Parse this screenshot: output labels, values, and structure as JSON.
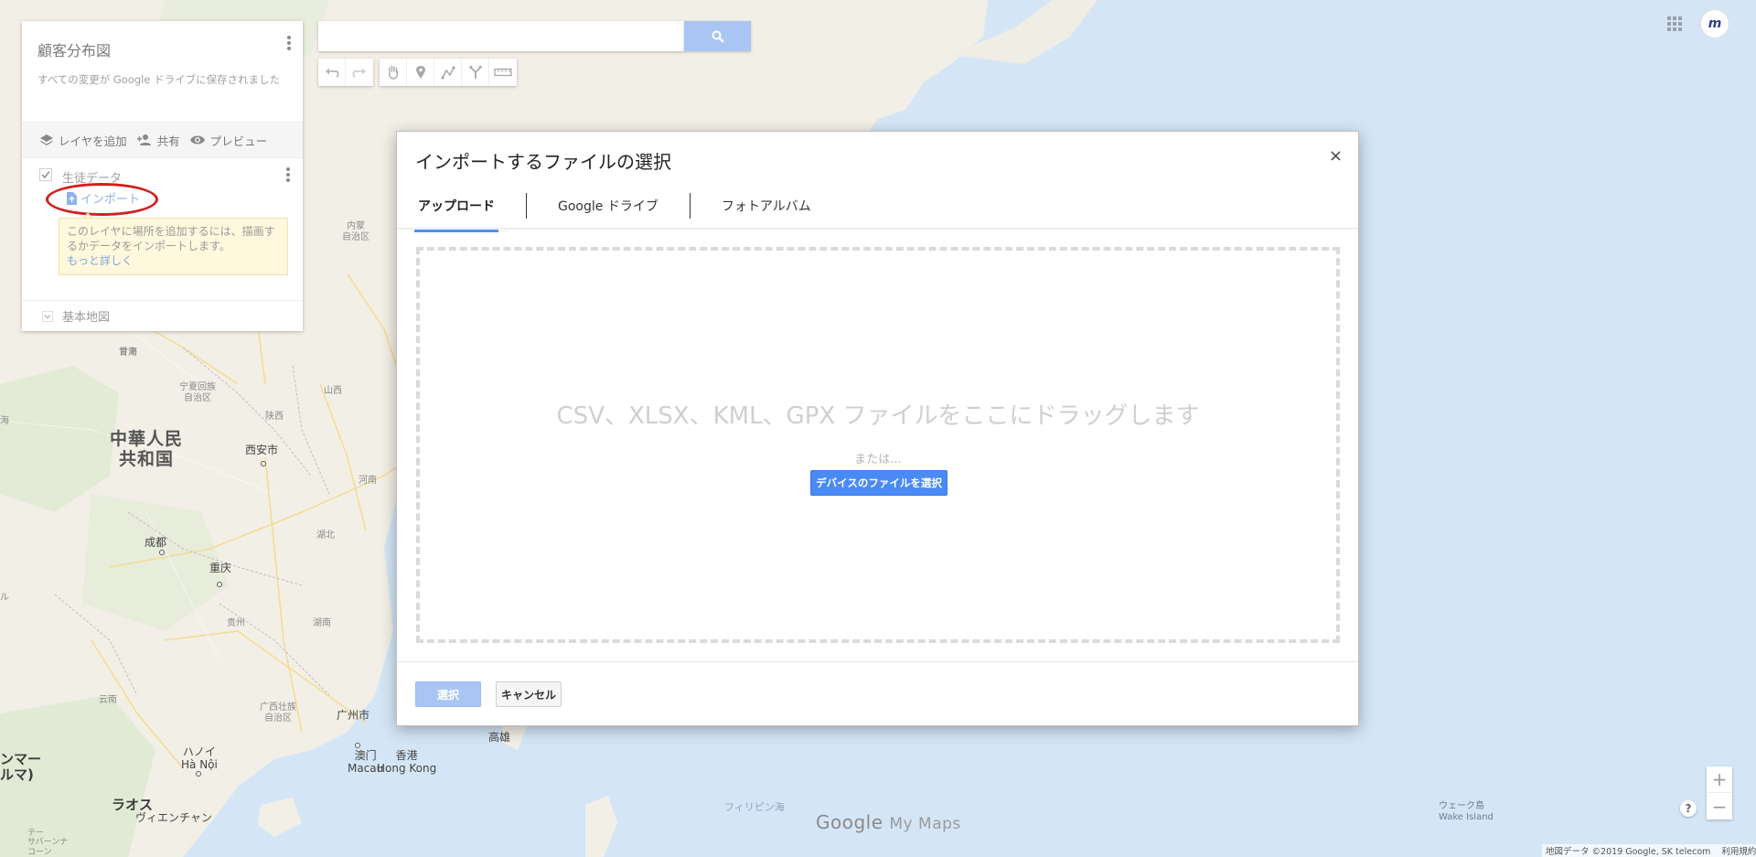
{
  "colors": {
    "water": "#d4e6f6",
    "land": "#f2efe6",
    "accent_blue": "#4a8af4",
    "disabled_blue": "#a9c5f3",
    "annotation_red": "#d21f1f",
    "hint_bg": "#fff8dc"
  },
  "left_panel": {
    "title": "顧客分布図",
    "save_status": "すべての変更が Google ドライブに保存されました",
    "actions": {
      "add_layer": "レイヤを追加",
      "share": "共有",
      "preview": "プレビュー"
    },
    "layer": {
      "name": "生徒データ",
      "import_label": "インポート",
      "hint_text": "このレイヤに場所を追加するには、描画するかデータをインポートします。",
      "hint_link": "もっと詳しく"
    },
    "base_map_label": "基本地図"
  },
  "search": {
    "value": "",
    "placeholder": ""
  },
  "toolbar": {
    "icons": [
      "undo-icon",
      "redo-icon",
      "hand-icon",
      "marker-icon",
      "draw-line-icon",
      "directions-icon",
      "ruler-icon"
    ]
  },
  "top_right": {
    "avatar_text": "m"
  },
  "map_labels": {
    "china": "中華人民\n共和国",
    "xian": "西安市",
    "chengdu": "成都",
    "chongqing": "重庆",
    "guangzhou": "广州市",
    "macau": "澳门\nMacau",
    "hongkong": "香港\nHong Kong",
    "hanoi": "ハノイ\nHà Nội",
    "laos": "ラオス",
    "vientiane": "ヴィエンチャン",
    "myanmar": "ンマー\nルマ)",
    "kaohsiung": "高雄",
    "ningxia": "宁夏回族\n自治区",
    "gansu": "甘肃",
    "shaanxi": "陕西",
    "shanxi": "山西",
    "henan": "河南",
    "hubei": "湖北",
    "hunan": "湖南",
    "guizhou": "贵州",
    "yunnan": "云南",
    "guangxi": "广西壮族\n自治区",
    "inner_mongolia": "内蒙\n自治区",
    "qinghai": "青海",
    "philippine_sea": "フィリピン海",
    "wake_island": "ウェーク島\nWake Island",
    "left_edge_1": "ル",
    "left_edge_2": "海",
    "tai": "テー\nサバーンナ\nコーン"
  },
  "dialog": {
    "title": "インポートするファイルの選択",
    "close_label": "×",
    "tabs": [
      {
        "label": "アップロード",
        "active": true
      },
      {
        "label": "Google ドライブ",
        "active": false
      },
      {
        "label": "フォトアルバム",
        "active": false
      }
    ],
    "drop_text": "CSV、XLSX、KML、GPX ファイルをここにドラッグします",
    "or_text": "または...",
    "select_device_label": "デバイスのファイルを選択",
    "select_label": "選択",
    "cancel_label": "キャンセル"
  },
  "watermark": {
    "google": "Google",
    "my_maps": "My Maps"
  },
  "zoom": {
    "in": "+",
    "out": "−"
  },
  "help_label": "?",
  "attribution": {
    "map_data": "地図データ ©2019 Google, SK telecom",
    "terms": "利用規約"
  }
}
